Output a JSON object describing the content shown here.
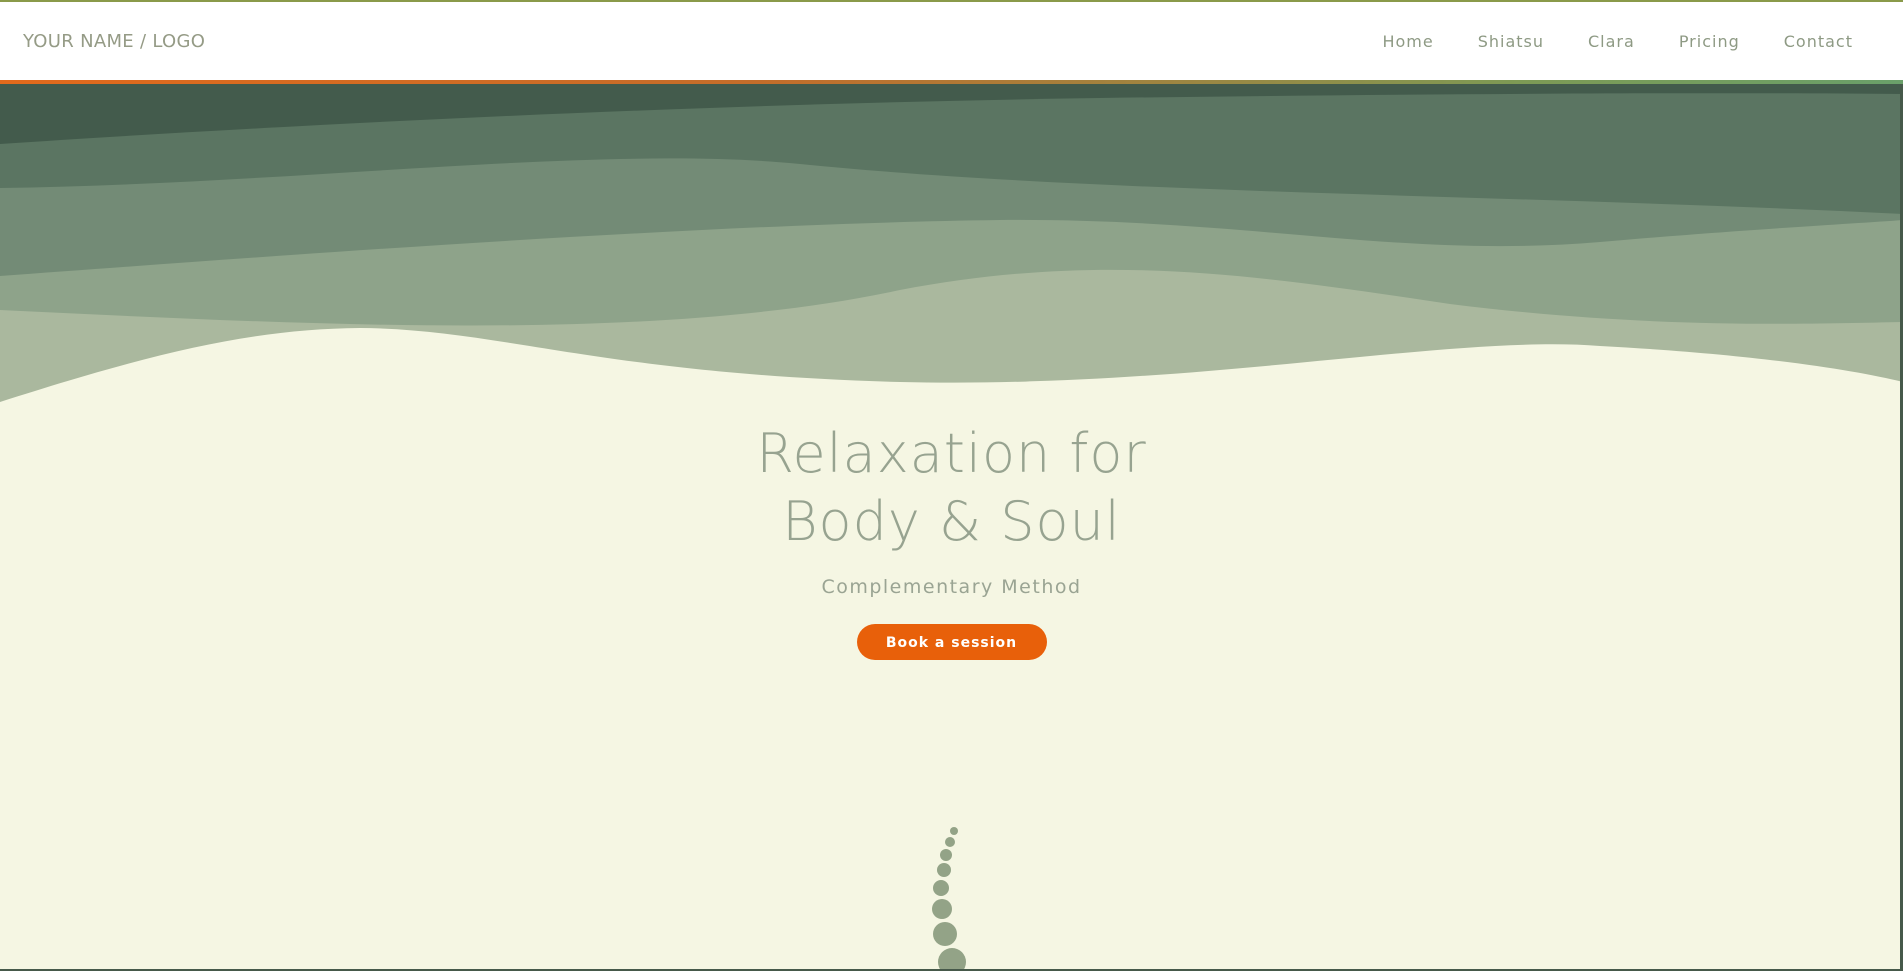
{
  "header": {
    "logo_text": "YOUR NAME / LOGO",
    "nav": [
      {
        "label": "Home"
      },
      {
        "label": "Shiatsu"
      },
      {
        "label": "Clara"
      },
      {
        "label": "Pricing"
      },
      {
        "label": "Contact"
      }
    ]
  },
  "hero": {
    "title_line1": "Relaxation for",
    "title_line2": "Body & Soul",
    "subtitle": "Complementary Method",
    "cta_label": "Book a session"
  },
  "colors": {
    "background": "#f5f6e3",
    "accent": "#e8600a",
    "text_muted": "#97a390",
    "wave_dark": "#435b4c",
    "wave_light": "#aab89e"
  },
  "icons": {
    "decor": "stacked-stones-icon"
  }
}
